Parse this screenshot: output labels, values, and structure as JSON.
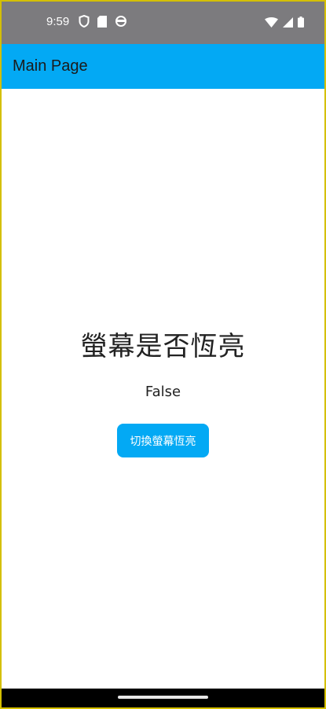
{
  "status_bar": {
    "time": "9:59",
    "icons_left": [
      "shield-icon",
      "sd-card-icon",
      "sync-icon"
    ],
    "icons_right": [
      "wifi-icon",
      "signal-icon",
      "battery-icon"
    ]
  },
  "app_bar": {
    "title": "Main Page",
    "color": "#03a9f4"
  },
  "main": {
    "heading": "螢幕是否恆亮",
    "value": "False",
    "button_label": "切換螢幕恆亮",
    "button_color": "#03a9f4"
  }
}
